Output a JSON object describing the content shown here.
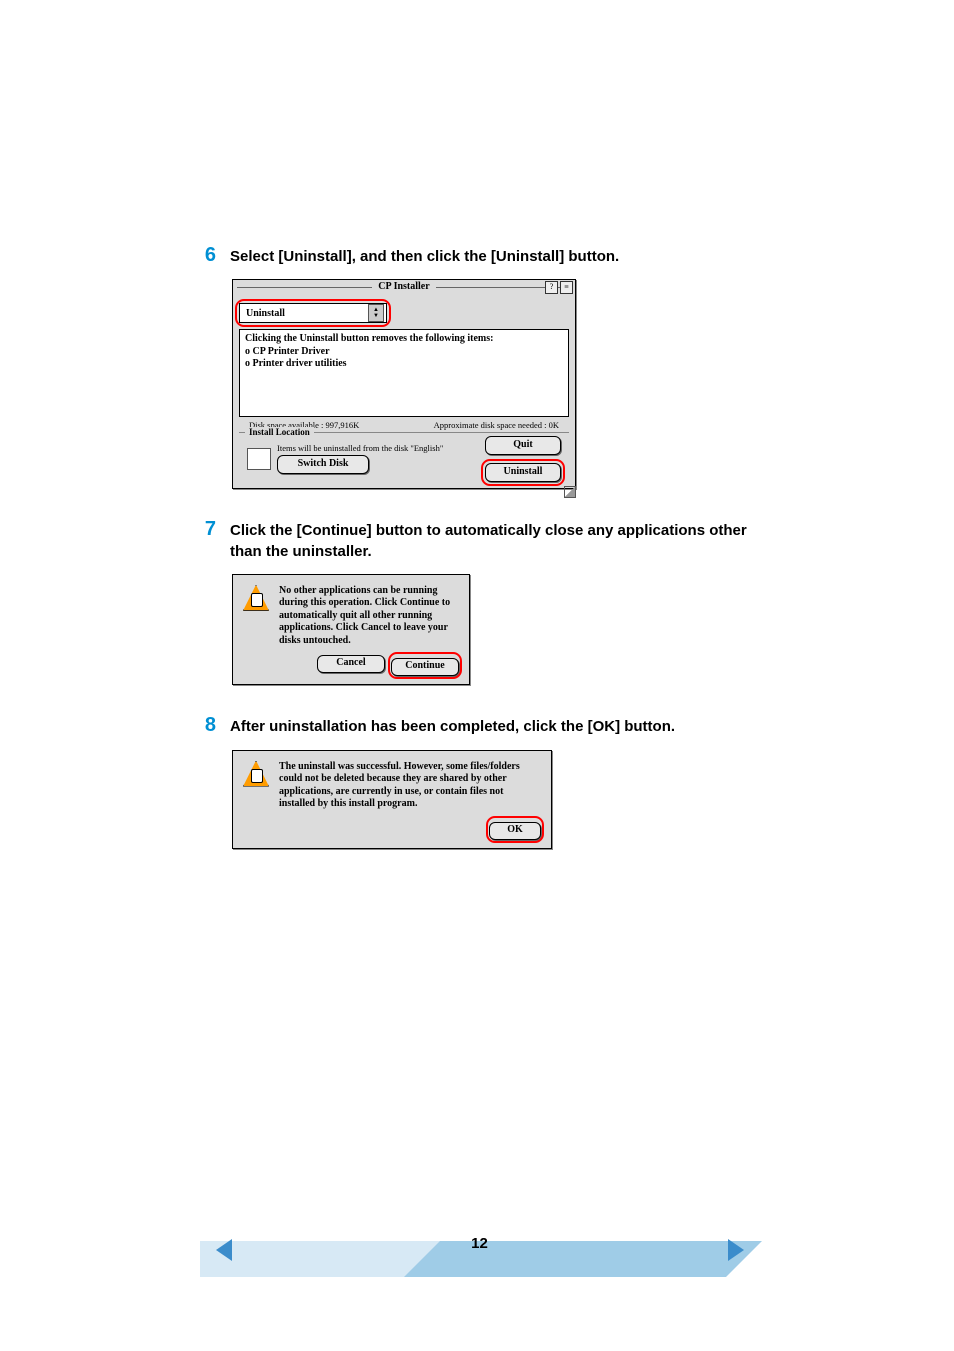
{
  "steps": {
    "s6": {
      "num": "6",
      "text": "Select [Uninstall], and then click the [Uninstall] button."
    },
    "s7": {
      "num": "7",
      "text": "Click the [Continue] button to automatically close any applications other than the uninstaller."
    },
    "s8": {
      "num": "8",
      "text": "After uninstallation has been completed, click the [OK] button."
    }
  },
  "dlg1": {
    "title": "CP Installer",
    "select_value": "Uninstall",
    "info_line1": "Clicking the Uninstall button removes the following items:",
    "info_line2": "o CP Printer Driver",
    "info_line3": "o Printer driver utilities",
    "disk_available": "Disk space available : 997,916K",
    "disk_needed": "Approximate disk space needed : 0K",
    "location_label": "Install Location",
    "location_text": "Items will be uninstalled from the disk \"English\"",
    "btn_switch": "Switch Disk",
    "btn_quit": "Quit",
    "btn_uninstall": "Uninstall"
  },
  "dlg2": {
    "text": "No other applications can be running during this operation.  Click Continue to automatically quit all other running applications.  Click Cancel to leave your disks untouched.",
    "btn_cancel": "Cancel",
    "btn_continue": "Continue"
  },
  "dlg3": {
    "text": "The uninstall was successful. However, some files/folders could not be deleted because they are shared by other applications, are currently in use, or contain files not installed by this install program.",
    "btn_ok": "OK"
  },
  "footer": {
    "page": "12"
  }
}
